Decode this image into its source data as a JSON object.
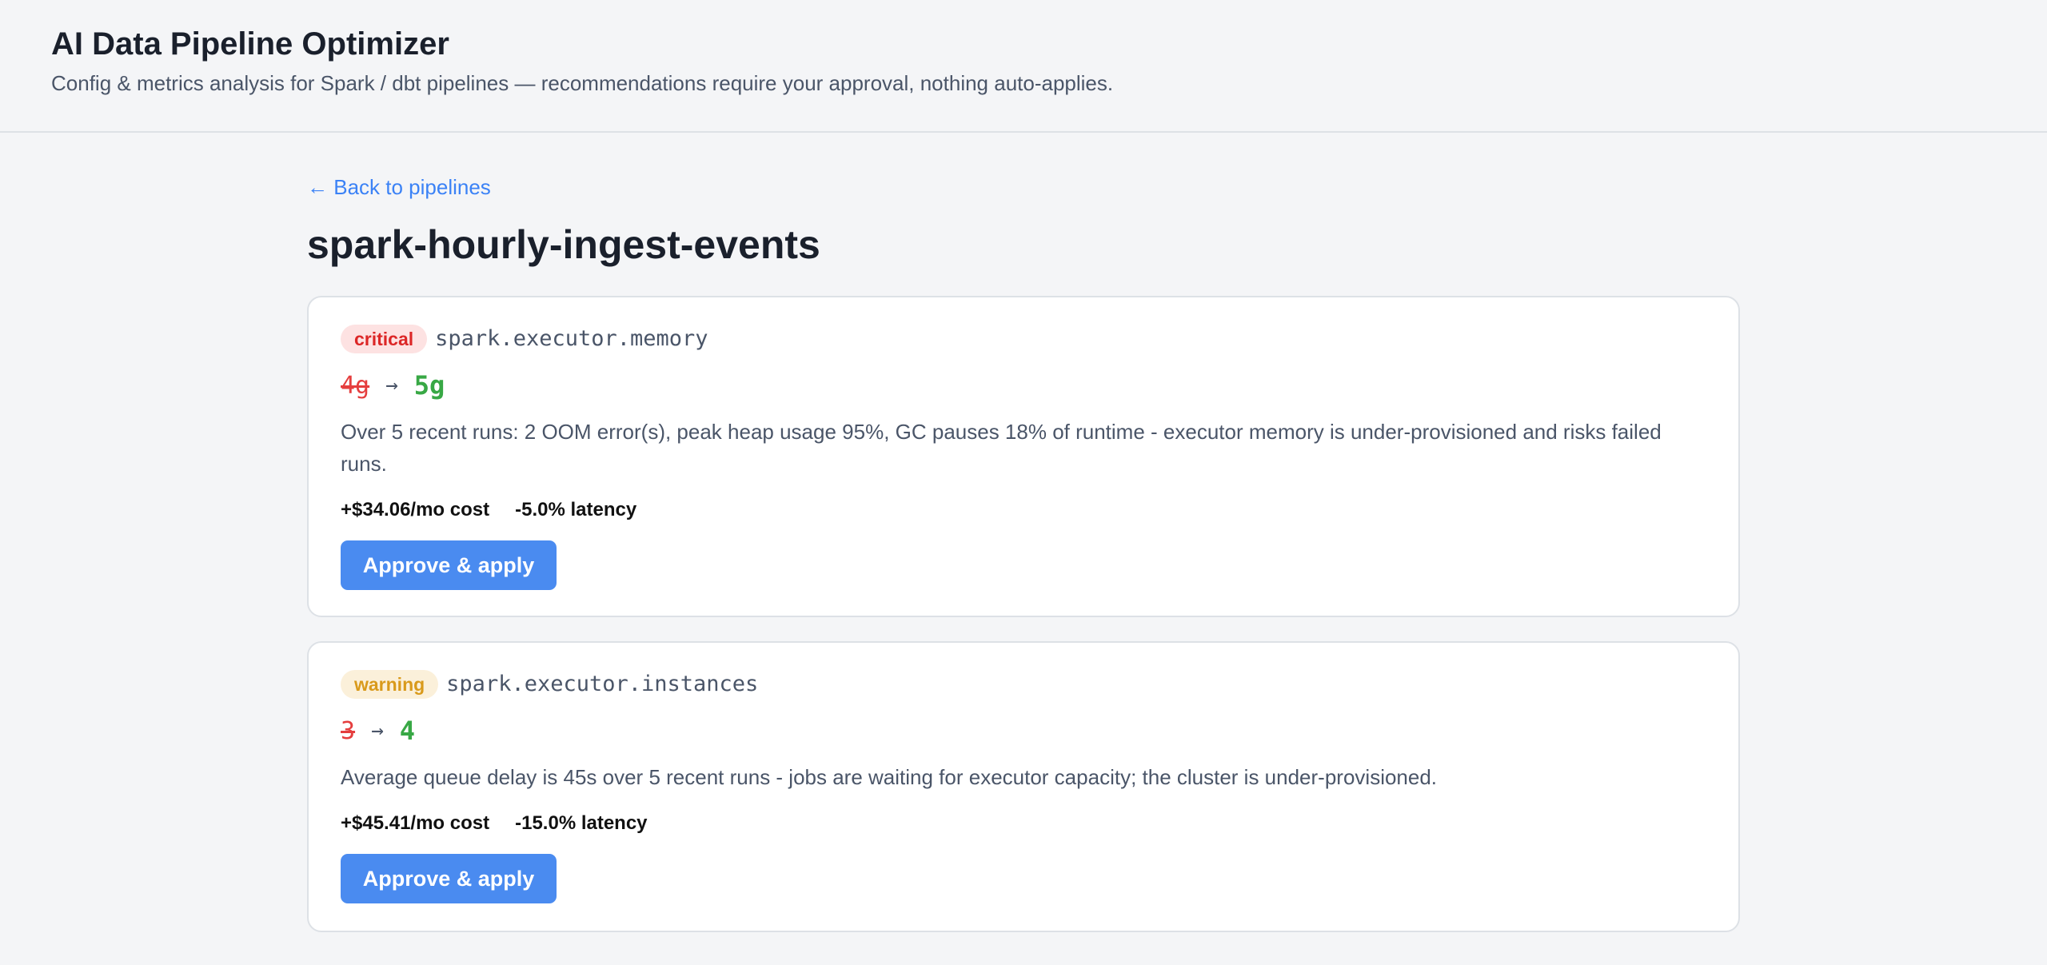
{
  "header": {
    "title": "AI Data Pipeline Optimizer",
    "subtitle": "Config & metrics analysis for Spark / dbt pipelines — recommendations require your approval, nothing auto-applies."
  },
  "nav": {
    "back_label": "← Back to pipelines"
  },
  "pipeline": {
    "name": "spark-hourly-ingest-events"
  },
  "recommendations": [
    {
      "severity": "critical",
      "config_key": "spark.executor.memory",
      "old_value": "4g",
      "arrow": "→",
      "new_value": "5g",
      "description": "Over 5 recent runs: 2 OOM error(s), peak heap usage 95%, GC pauses 18% of runtime - executor memory is under-provisioned and risks failed runs.",
      "cost_impact": "+$34.06/mo cost",
      "latency_impact": "-5.0% latency",
      "action_label": "Approve & apply"
    },
    {
      "severity": "warning",
      "config_key": "spark.executor.instances",
      "old_value": "3",
      "arrow": "→",
      "new_value": "4",
      "description": "Average queue delay is 45s over 5 recent runs - jobs are waiting for executor capacity; the cluster is under-provisioned.",
      "cost_impact": "+$45.41/mo cost",
      "latency_impact": "-15.0% latency",
      "action_label": "Approve & apply"
    }
  ],
  "colors": {
    "background": "#f4f5f7",
    "card": "#ffffff",
    "primary": "#4a8bf0",
    "link": "#3b82f6",
    "critical": "#dc2626",
    "warning": "#d99a1b",
    "old_value": "#e53e3e",
    "new_value": "#38a845"
  }
}
